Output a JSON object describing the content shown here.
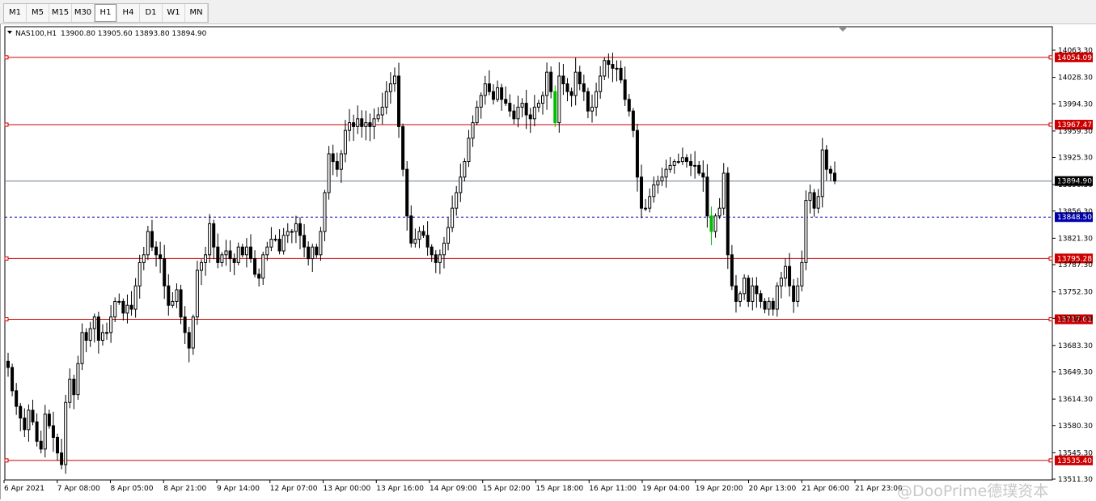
{
  "toolbar": {
    "timeframes": [
      "M1",
      "M5",
      "M15",
      "M30",
      "H1",
      "H4",
      "D1",
      "W1",
      "MN"
    ],
    "active": "H1"
  },
  "header": {
    "symbol": "NAS100,H1",
    "ohlc": "13900.80 13905.60 13893.80 13894.90"
  },
  "colors": {
    "level_line": "#cc0000",
    "current_price_line": "#6f7f8f",
    "dashed_line": "#0000aa",
    "candle": "#000000",
    "bull_candle_accent": "#00c000",
    "tag_text": "#ffffff"
  },
  "watermark": "@DooPrime德璞资本",
  "chart_data": {
    "type": "candlestick",
    "symbol": "NAS100",
    "timeframe": "H1",
    "ylim": [
      13511.3,
      14063.3
    ],
    "y_ticks": [
      "14063.30",
      "14028.30",
      "13994.30",
      "13959.30",
      "13925.30",
      "13890.30",
      "13856.30",
      "13821.30",
      "13787.30",
      "13752.30",
      "13718.30",
      "13683.30",
      "13649.30",
      "13614.30",
      "13580.30",
      "13545.30",
      "13511.30"
    ],
    "x_tick_labels": [
      "6 Apr 2021",
      "7 Apr 08:00",
      "8 Apr 05:00",
      "8 Apr 21:00",
      "9 Apr 14:00",
      "12 Apr 07:00",
      "13 Apr 00:00",
      "13 Apr 16:00",
      "14 Apr 09:00",
      "15 Apr 02:00",
      "15 Apr 18:00",
      "16 Apr 11:00",
      "19 Apr 04:00",
      "19 Apr 20:00",
      "20 Apr 13:00",
      "21 Apr 06:00",
      "21 Apr 23:00"
    ],
    "horizontal_levels": [
      14054.09,
      13967.47,
      13795.28,
      13717.01,
      13535.4
    ],
    "level_labels": [
      "14054.09",
      "13967.47",
      "13795.28",
      "13717.01",
      "13535.40"
    ],
    "dashed_level": 13848.5,
    "dashed_label": "13848.50",
    "current_price": 13894.9,
    "current_price_label": "13894.90",
    "closes": [
      13655,
      13625,
      13605,
      13590,
      13575,
      13600,
      13585,
      13560,
      13550,
      13595,
      13580,
      13565,
      13545,
      13530,
      13610,
      13640,
      13620,
      13660,
      13700,
      13690,
      13705,
      13720,
      13690,
      13700,
      13700,
      13720,
      13740,
      13740,
      13725,
      13735,
      13730,
      13760,
      13790,
      13800,
      13830,
      13810,
      13800,
      13795,
      13760,
      13735,
      13740,
      13755,
      13720,
      13700,
      13680,
      13720,
      13780,
      13790,
      13800,
      13840,
      13810,
      13790,
      13800,
      13805,
      13795,
      13790,
      13810,
      13800,
      13810,
      13795,
      13775,
      13770,
      13800,
      13810,
      13820,
      13820,
      13805,
      13825,
      13830,
      13830,
      13840,
      13825,
      13810,
      13795,
      13810,
      13800,
      13830,
      13880,
      13930,
      13920,
      13910,
      13930,
      13960,
      13970,
      13965,
      13975,
      13965,
      13970,
      13965,
      13975,
      13980,
      13990,
      14010,
      14020,
      14030,
      13965,
      13910,
      13850,
      13815,
      13820,
      13830,
      13825,
      13810,
      13800,
      13790,
      13800,
      13815,
      13835,
      13860,
      13880,
      13900,
      13920,
      13950,
      13970,
      13990,
      14005,
      14020,
      14010,
      14000,
      14015,
      14000,
      13995,
      13985,
      13975,
      13990,
      13995,
      13980,
      13975,
      13990,
      13995,
      14005,
      14035,
      14010,
      13970,
      14030,
      14020,
      14010,
      14005,
      14035,
      14020,
      14010,
      13985,
      13990,
      14010,
      14030,
      14050,
      14045,
      14040,
      14040,
      14025,
      14000,
      13985,
      13960,
      13900,
      13860,
      13860,
      13875,
      13890,
      13895,
      13900,
      13910,
      13915,
      13920,
      13920,
      13925,
      13920,
      13915,
      13915,
      13905,
      13900,
      13850,
      13830,
      13850,
      13860,
      13905,
      13800,
      13760,
      13740,
      13750,
      13770,
      13740,
      13760,
      13750,
      13740,
      13730,
      13740,
      13730,
      13760,
      13770,
      13785,
      13760,
      13740,
      13760,
      13790,
      13870,
      13880,
      13860,
      13875,
      13935,
      13910,
      13905,
      13895
    ]
  }
}
